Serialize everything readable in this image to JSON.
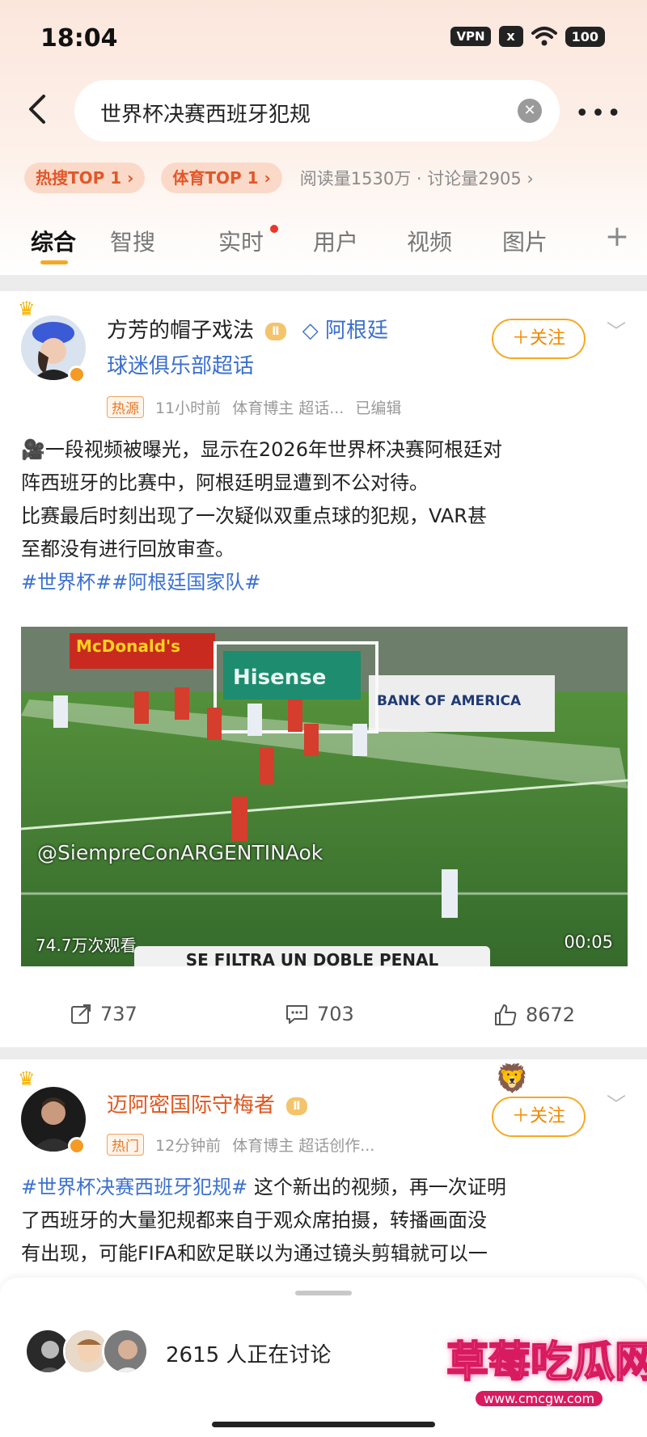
{
  "status_bar": {
    "time": "18:04",
    "vpn": "VPN",
    "x_badge": "x",
    "battery": "100"
  },
  "search": {
    "query": "世界杯决赛西班牙犯规",
    "clear_icon": "close-circle-icon",
    "back_icon": "chevron-left-icon",
    "more_icon": "more-horizontal-icon"
  },
  "trend": {
    "hot_chip": "热搜TOP 1 ›",
    "sports_chip": "体育TOP 1 ›",
    "stats": "阅读量1530万 · 讨论量2905 ›"
  },
  "tabs": [
    {
      "label": "综合",
      "active": true
    },
    {
      "label": "智搜"
    },
    {
      "label": "实时"
    },
    {
      "label": "用户"
    },
    {
      "label": "视频"
    },
    {
      "label": "图片"
    },
    {
      "label": "+"
    }
  ],
  "post1": {
    "user_name": "方芳的帽子戏法",
    "level": "Ⅱ",
    "group_name_line1": "◇ 阿根廷",
    "group_name_line2": "球迷俱乐部超话",
    "follow_label": "＋关注",
    "meta_tag": "热源",
    "meta_time": "11小时前",
    "meta_role": "体育博主 超话...",
    "meta_edited": "已编辑",
    "text_line1": "🎥一段视频被曝光，显示在2026年世界杯决赛阿根廷对",
    "text_line2": "阵西班牙的比赛中，阿根廷明显遭到不公对待。",
    "text_line3": "比赛最后时刻出现了一次疑似双重点球的犯规，VAR甚",
    "text_line4": "至都没有进行回放审查。",
    "hashtags": "#世界杯##阿根廷国家队#",
    "video": {
      "board1": "McDonald's",
      "board2": "Hisense",
      "board3": "BANK OF AMERICA",
      "watermark": "@SiempreConARGENTINAok",
      "views": "74.7万次观看",
      "duration": "00:05",
      "caption": "SE FILTRA UN DOBLE PENAL"
    },
    "reposts": "737",
    "comments": "703",
    "likes": "8672"
  },
  "post2": {
    "user_name": "迈阿密国际守梅者",
    "level": "Ⅱ",
    "follow_label": "＋关注",
    "meta_tag": "热门",
    "meta_time": "12分钟前",
    "meta_role": "体育博主 超话创作...",
    "hashtag": "#世界杯决赛西班牙犯规#",
    "text_after_hashtag": " 这个新出的视频，再一次证明",
    "text_line2": "了西班牙的大量犯规都来自于观众席拍摄，转播画面没",
    "text_line3": "有出现，可能FIFA和欧足联以为通过镜头剪辑就可以一"
  },
  "discussion": {
    "count_text": "2615 人正在讨论"
  },
  "watermark_logo": {
    "title": "草莓吃瓜网",
    "url": "www.cmcgw.com"
  },
  "colors": {
    "accent_orange": "#f7a823",
    "link_blue": "#3a6fcf",
    "hot_red": "#e2572a"
  }
}
